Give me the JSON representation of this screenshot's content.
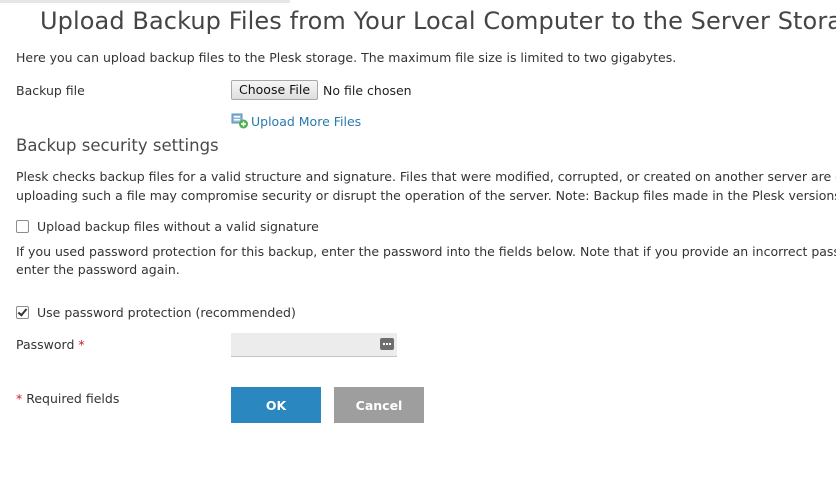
{
  "page": {
    "title": "Upload Backup Files from Your Local Computer to the Server Storage",
    "intro": "Here you can upload backup files to the Plesk storage. The maximum file size is limited to two gigabytes."
  },
  "backup_file": {
    "label": "Backup file",
    "choose_button": "Choose File",
    "status": "No file chosen",
    "upload_more_link": "Upload More Files",
    "upload_more_icon": "upload-files-icon"
  },
  "security": {
    "title": "Backup security settings",
    "description_line1": "Plesk checks backup files for a valid structure and signature. Files that were modified, corrupted, or created on another server are distru",
    "description_line2": "uploading such a file may compromise security or disrupt the operation of the server. Note: Backup files made in the Plesk versions pric",
    "no_signature_checkbox": {
      "label": "Upload backup files without a valid signature",
      "checked": false
    },
    "password_description_line1": "If you used password protection for this backup, enter the password into the fields below. Note that if you provide an incorrect passwor",
    "password_description_line2": "enter the password again.",
    "password_protection_checkbox": {
      "label": "Use password protection (recommended)",
      "checked": true
    }
  },
  "password": {
    "label": "Password",
    "required_marker": "*",
    "value": "",
    "manager_icon": "password-manager-icon"
  },
  "footer": {
    "required_marker": "*",
    "required_note": "Required fields",
    "ok_button": "OK",
    "cancel_button": "Cancel"
  },
  "colors": {
    "primary_button": "#2b87bf",
    "secondary_button": "#9e9e9e",
    "link": "#2a7ab0",
    "required": "#d02020"
  }
}
